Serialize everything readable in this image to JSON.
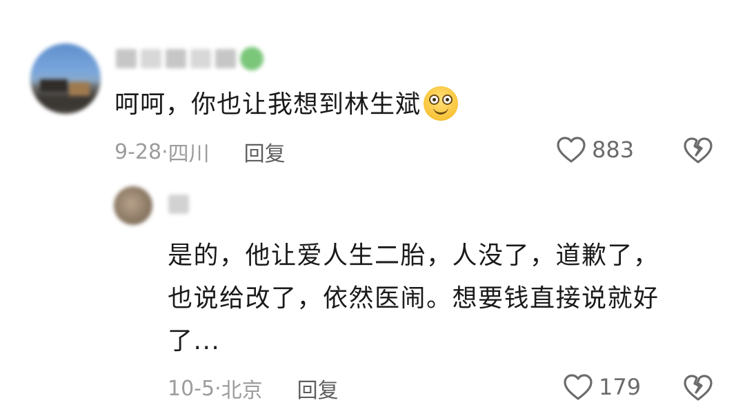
{
  "comments": [
    {
      "text": "呵呵，你也让我想到林生斌",
      "emoji": "smiley-face-emoji",
      "date": "9-28·",
      "location": "四川",
      "reply_label": "回复",
      "like_count": "883"
    }
  ],
  "reply": {
    "lines": [
      "是的，他让爱人生二胎，人没了，道歉了，",
      "也说给改了，依然医闹。想要钱直接说就好",
      "了..."
    ],
    "date": "10-5·",
    "location": "北京",
    "reply_label": "回复",
    "like_count": "179"
  },
  "icons": {
    "like": "heart-outline-icon",
    "dislike": "broken-heart-icon"
  },
  "colors": {
    "text_primary": "#1a1a1a",
    "text_meta": "#9c9c9c",
    "reply_label": "#5e5e5e",
    "icon": "#6b6b6b",
    "emoji_yellow": "#f9c43a"
  }
}
